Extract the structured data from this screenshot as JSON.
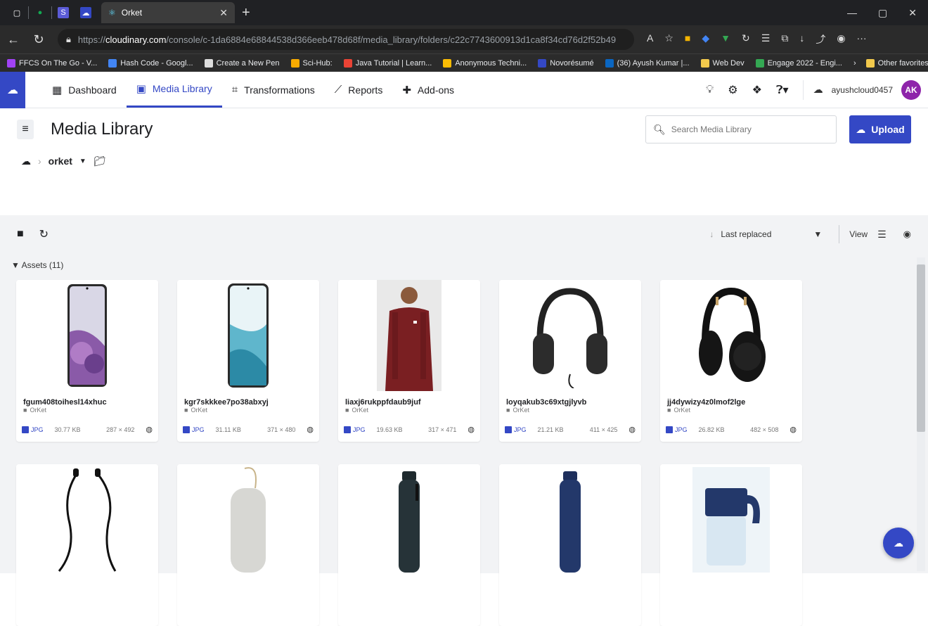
{
  "browser": {
    "tab_title": "Orket",
    "url_prefix": "https://",
    "url_domain": "cloudinary.com",
    "url_rest": "/console/c-1da6884e68844538d366eeb478d68f/media_library/folders/c22c7743600913d1ca8f34cd76d2f52b49"
  },
  "bookmarks": [
    {
      "label": "FFCS On The Go - V...",
      "color": "#a142f4"
    },
    {
      "label": "Hash Code - Googl...",
      "color": "#4285f4"
    },
    {
      "label": "Create a New Pen",
      "color": "#dddddd"
    },
    {
      "label": "Sci-Hub:",
      "color": "#f9ab00"
    },
    {
      "label": "Java Tutorial | Learn...",
      "color": "#ea4335"
    },
    {
      "label": "Anonymous Techni...",
      "color": "#fbbc04"
    },
    {
      "label": "Novorésumé",
      "color": "#3448c5"
    },
    {
      "label": "(36) Ayush Kumar |...",
      "color": "#0a66c2"
    },
    {
      "label": "Web Dev",
      "color": "#f2c94c"
    },
    {
      "label": "Engage 2022 - Engi...",
      "color": "#34a853"
    }
  ],
  "bookmarks_other": "Other favorites",
  "nav": {
    "dashboard": "Dashboard",
    "media_library": "Media Library",
    "transformations": "Transformations",
    "reports": "Reports",
    "addons": "Add-ons"
  },
  "account": {
    "name": "ayushcloud0457",
    "initials": "AK"
  },
  "page": {
    "title": "Media Library",
    "search_placeholder": "Search Media Library",
    "upload_label": "Upload",
    "breadcrumb_folder": "orket"
  },
  "toolbar": {
    "sort_label": "Last replaced",
    "view_label": "View"
  },
  "assets_header": "Assets (11)",
  "assets": [
    {
      "name": "fgum408toihesl14xhuc",
      "folder": "OrKet",
      "format": "JPG",
      "size": "30.77 KB",
      "dims": "287 × 492"
    },
    {
      "name": "kgr7skkkee7po38abxyj",
      "folder": "OrKet",
      "format": "JPG",
      "size": "31.11 KB",
      "dims": "371 × 480"
    },
    {
      "name": "liaxj6rukppfdaub9juf",
      "folder": "OrKet",
      "format": "JPG",
      "size": "19.63 KB",
      "dims": "317 × 471"
    },
    {
      "name": "loyqakub3c69xtgjlyvb",
      "folder": "OrKet",
      "format": "JPG",
      "size": "21.21 KB",
      "dims": "411 × 425"
    },
    {
      "name": "jj4dywizy4z0lmof2lge",
      "folder": "OrKet",
      "format": "JPG",
      "size": "26.82 KB",
      "dims": "482 × 508"
    }
  ],
  "colors": {
    "accent": "#3448c5",
    "avatar": "#8e24aa"
  }
}
